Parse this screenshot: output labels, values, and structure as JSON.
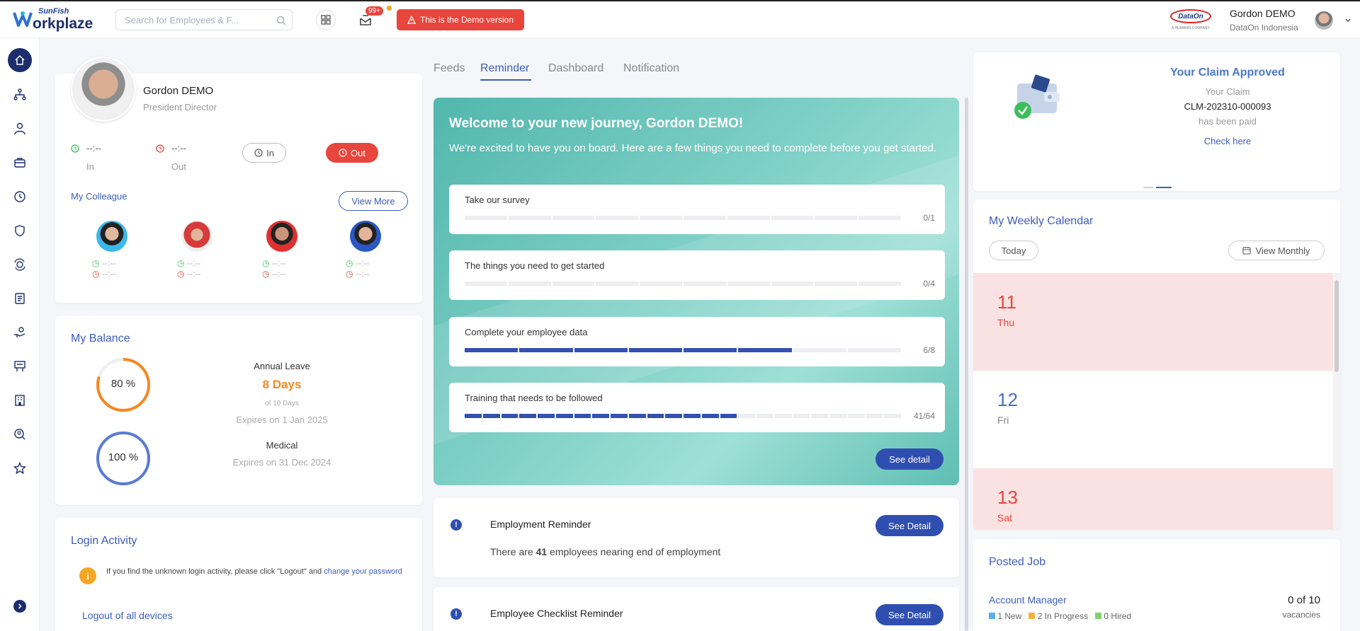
{
  "app": {
    "brand_small": "SunFish",
    "brand": "orkplaze",
    "search_placeholder": "Search for Employees & F...",
    "badge": "99+",
    "demo_banner": "This is the Demo version",
    "user_name": "Gordon DEMO",
    "user_company": "DataOn Indonesia",
    "partner_logo": "DataOn",
    "partner_tagline": "A HUMANIS COMPANY"
  },
  "sidebar": {
    "icons": [
      "home-icon",
      "org-chart-icon",
      "person-icon",
      "briefcase-icon",
      "clock-icon",
      "shield-icon",
      "money-exchange-icon",
      "invoice-icon",
      "hand-coin-icon",
      "training-icon",
      "building-icon",
      "search-person-icon",
      "star-icon"
    ],
    "expand": "chevron-right-icon"
  },
  "profile": {
    "name": "Gordon DEMO",
    "title": "President Director",
    "in_time": "--:--",
    "in_label": "In",
    "out_time": "--:--",
    "out_label": "Out",
    "in_button": "In",
    "out_button": "Out",
    "colleague_title": "My Colleague",
    "view_more": "View More",
    "colleague_times": [
      "--:--",
      "--:--"
    ]
  },
  "balance": {
    "title": "My Balance",
    "items": [
      {
        "percent_text": "80 %",
        "percent": 80,
        "name": "Annual Leave",
        "days": "8 Days",
        "of": "of 10 Days",
        "expires": "Expires on 1 Jan 2025",
        "color": "#f5881f"
      },
      {
        "percent_text": "100 %",
        "percent": 100,
        "name": "Medical",
        "expires": "Expires on 31 Dec 2024",
        "color": "#5a7bd4"
      }
    ]
  },
  "login": {
    "title": "Login Activity",
    "note": "If you find the unknown login activity, please click \"Logout\" and ",
    "link": "change your password",
    "logout_all": "Logout of all devices"
  },
  "tabs": [
    "Feeds",
    "Reminder",
    "Dashboard",
    "Notification"
  ],
  "onboarding": {
    "title": "Welcome to your new journey, Gordon DEMO!",
    "subtitle": "We're excited to have you on board. Here are a few things you need to complete before you get started.",
    "see_detail": "See detail",
    "tasks": [
      {
        "label": "Take our survey",
        "count": "0/1",
        "done": 0,
        "total": 1
      },
      {
        "label": "The things you need to get started",
        "count": "0/4",
        "done": 0,
        "total": 4
      },
      {
        "label": "Complete your employee data",
        "count": "6/8",
        "done": 6,
        "total": 8
      },
      {
        "label": "Training that needs to be followed",
        "count": "41/64",
        "done": 41,
        "total": 64
      }
    ]
  },
  "reminders": [
    {
      "title": "Employment Reminder",
      "button": "See Detail",
      "text_pre": "There are ",
      "number": "41",
      "text_post": " employees nearing end of employment"
    },
    {
      "title": "Employee Checklist Reminder",
      "button": "See Detail"
    }
  ],
  "claim": {
    "title": "Your Claim Approved",
    "line1": "Your Claim",
    "code": "CLM-202310-000093",
    "line2": "has been paid",
    "link": "Check here"
  },
  "calendar": {
    "title": "My Weekly Calendar",
    "today": "Today",
    "view_monthly": "View Monthly",
    "days": [
      {
        "num": "11",
        "day": "Thu",
        "highlight": true
      },
      {
        "num": "12",
        "day": "Fri",
        "highlight": false
      },
      {
        "num": "13",
        "day": "Sat",
        "highlight": true
      }
    ]
  },
  "jobs": {
    "title": "Posted Job",
    "items": [
      {
        "title": "Account Manager",
        "count": "0 of 10",
        "unit": "vacancies",
        "new": "1 New",
        "progress": "2 In Progress",
        "hired": "0 Hired"
      }
    ]
  }
}
